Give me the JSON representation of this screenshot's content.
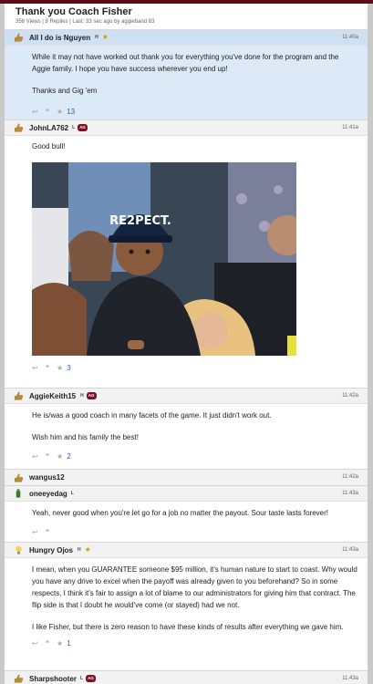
{
  "thread": {
    "title": "Thank you Coach Fisher",
    "meta": "358 Views | 8 Replies | Last: 33 sec ago by aggieband 83"
  },
  "posts": [
    {
      "username": "All I do is Nguyen",
      "badges": [
        "H",
        "star"
      ],
      "time": "11:40a",
      "paragraphs": [
        "While it may not have worked out thank you for everything you've done for the program and the Aggie family. I hope you have success wherever you end up!",
        "Thanks and Gig 'em"
      ],
      "likes": "13"
    },
    {
      "username": "JohnLA762",
      "badges": [
        "L",
        "AG"
      ],
      "time": "11:41a",
      "paragraphs": [
        "Good bull!"
      ],
      "image": {
        "alt": "child in crowd wearing RE2PECT cap",
        "cap_text": "RE2PECT."
      },
      "likes": "3"
    },
    {
      "username": "AggieKeith15",
      "badges": [
        "H",
        "AG"
      ],
      "time": "11:42a",
      "paragraphs": [
        "He is/was a good coach in many facets of the game. It just didn't work out.",
        "Wish him and his family the best!"
      ],
      "likes": "2"
    },
    {
      "username": "wangus12",
      "time": "11:42a"
    },
    {
      "username": "oneeyedag",
      "badges": [
        "L"
      ],
      "time": "11:43a",
      "paragraphs": [
        "Yeah, never good when you're let go for a job no matter the payout. Sour taste lasts forever!"
      ]
    },
    {
      "username": "Hungry Ojos",
      "badges": [
        "H",
        "star"
      ],
      "time": "11:43a",
      "paragraphs": [
        "I mean, when you GUARANTEE someone $95 million, it's human nature to start to coast. Why would you have any drive to excel when the payoff was already given to you beforehand? So in some respects, I think it's fair to assign a lot of blame to our administrators for giving him that contract. The flip side is that I doubt he would've come (or stayed) had we not.",
        "I like Fisher, but there is zero reason to have these kinds of results after everything we gave him."
      ],
      "likes": "1"
    },
    {
      "username": "Sharpshooter",
      "badges": [
        "L",
        "AG"
      ],
      "time": "11:43a"
    }
  ],
  "labels": {
    "H": "H",
    "L": "L",
    "AG": "AG",
    "star": "★"
  },
  "icons": {
    "reply": "reply-icon",
    "quote": "quote-icon",
    "like": "star-icon"
  },
  "colors": {
    "brand": "#5a0f1a",
    "highlight": "#dce9f7",
    "badge_ag": "#7a1124",
    "link": "#2a5db0"
  }
}
